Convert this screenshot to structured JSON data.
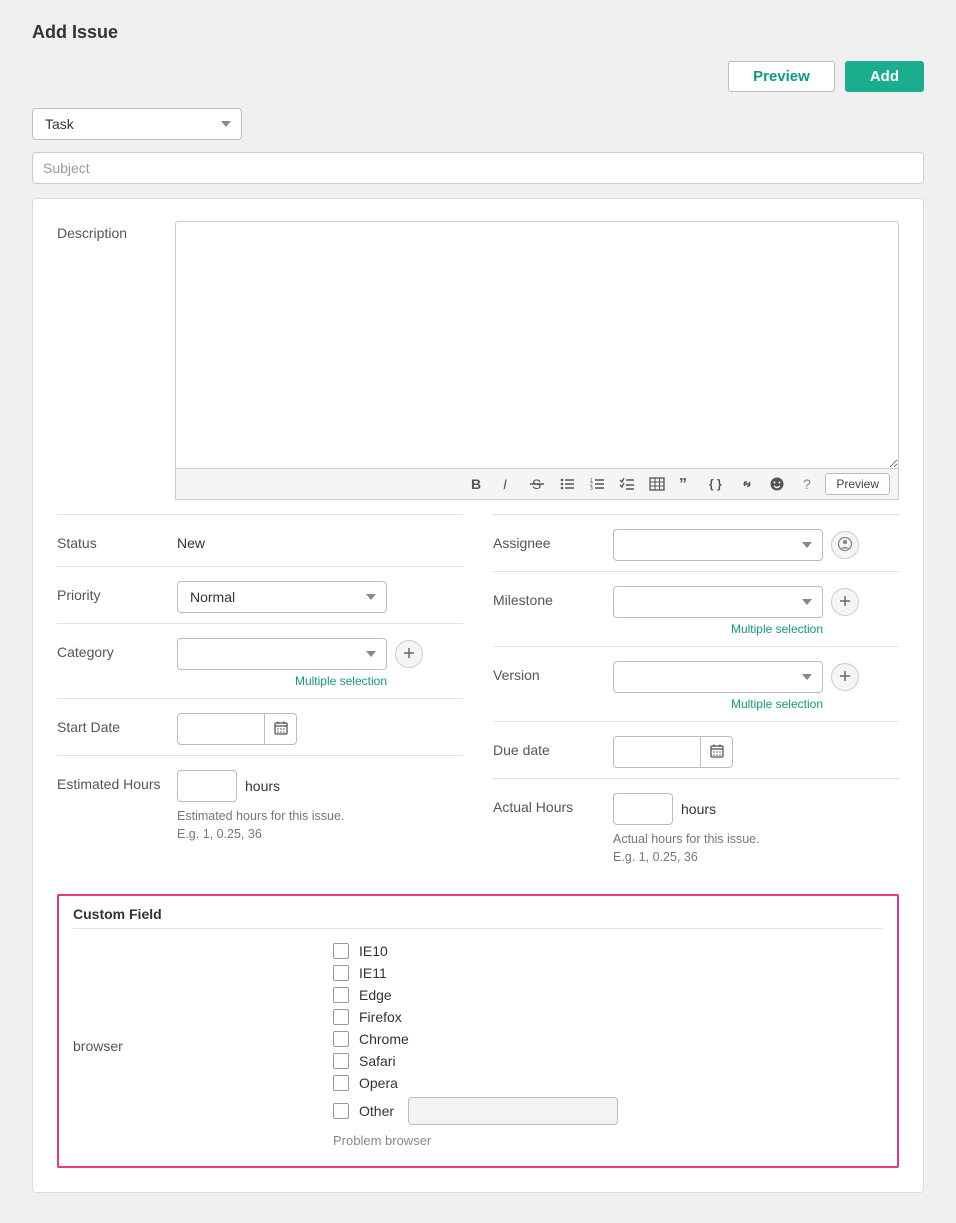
{
  "page_title": "Add Issue",
  "buttons": {
    "preview": "Preview",
    "add": "Add"
  },
  "issue_type": {
    "selected": "Task"
  },
  "subject": {
    "placeholder": "Subject",
    "value": ""
  },
  "description": {
    "label": "Description",
    "value": "",
    "toolbar_preview": "Preview"
  },
  "left_fields": {
    "status": {
      "label": "Status",
      "value": "New"
    },
    "priority": {
      "label": "Priority",
      "value": "Normal"
    },
    "category": {
      "label": "Category",
      "value": "",
      "multi_link": "Multiple selection"
    },
    "start_date": {
      "label": "Start Date",
      "value": ""
    },
    "est_hours": {
      "label": "Estimated Hours",
      "unit": "hours",
      "value": "",
      "help1": "Estimated hours for this issue.",
      "help2": "E.g. 1, 0.25, 36"
    }
  },
  "right_fields": {
    "assignee": {
      "label": "Assignee",
      "value": ""
    },
    "milestone": {
      "label": "Milestone",
      "value": "",
      "multi_link": "Multiple selection"
    },
    "version": {
      "label": "Version",
      "value": "",
      "multi_link": "Multiple selection"
    },
    "due_date": {
      "label": "Due date",
      "value": ""
    },
    "actual_hours": {
      "label": "Actual Hours",
      "unit": "hours",
      "value": "",
      "help1": "Actual hours for this issue.",
      "help2": "E.g. 1, 0.25, 36"
    }
  },
  "custom": {
    "section_title": "Custom Field",
    "field_label": "browser",
    "options": [
      "IE10",
      "IE11",
      "Edge",
      "Firefox",
      "Chrome",
      "Safari",
      "Opera"
    ],
    "other_label": "Other",
    "help": "Problem browser"
  }
}
